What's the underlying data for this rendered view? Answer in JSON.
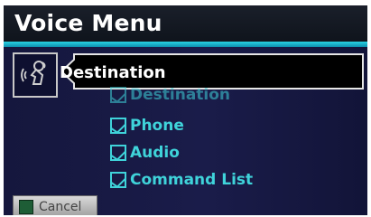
{
  "header": {
    "title": "Voice Menu"
  },
  "prompt": {
    "text": "Destination"
  },
  "menu": {
    "items": [
      {
        "label": "Destination"
      },
      {
        "label": "Phone"
      },
      {
        "label": "Audio"
      },
      {
        "label": "Command List"
      }
    ]
  },
  "footer": {
    "cancel_label": "Cancel"
  },
  "colors": {
    "accent": "#29d3e3",
    "item_text": "#3fd3da",
    "background": "#1a1c4a"
  },
  "icons": {
    "voice": "voice-person-icon",
    "item": "check-square-icon",
    "cancel": "cancel-square-icon"
  }
}
